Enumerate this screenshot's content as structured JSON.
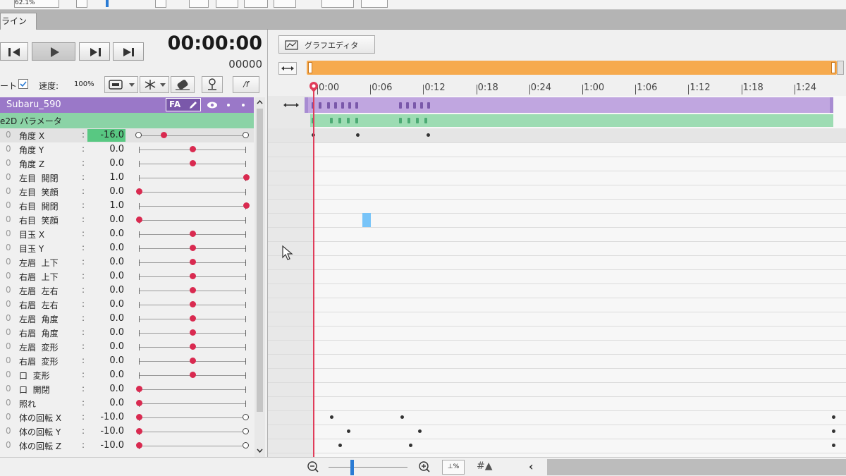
{
  "toolbar": {
    "zoom_fragment": "62.1%"
  },
  "tab": {
    "label": "ライン"
  },
  "playback": {
    "timecode": "00:00:00",
    "frame": "00000"
  },
  "options": {
    "label": "ート",
    "checked": true,
    "speed_label": "速度:",
    "speed_value": "100%",
    "script_label": "/f"
  },
  "layer": {
    "name": "Subaru_590",
    "badge": "FA"
  },
  "group": {
    "name": "e2D パラメータ"
  },
  "params": [
    {
      "name": "角度 X",
      "value": "-16.0",
      "pos": 0.23,
      "left_end": "circle",
      "right_end": "circle"
    },
    {
      "name": "角度 Y",
      "value": "0.0",
      "pos": 0.5,
      "left_end": "tick",
      "right_end": "tick"
    },
    {
      "name": "角度 Z",
      "value": "0.0",
      "pos": 0.5,
      "left_end": "tick",
      "right_end": "tick"
    },
    {
      "name": "左目  開閉",
      "value": "1.0",
      "pos": 1.0,
      "left_end": "tick",
      "right_end": "tick"
    },
    {
      "name": "左目  笑顔",
      "value": "0.0",
      "pos": 0.0,
      "left_end": "tick",
      "right_end": "tick"
    },
    {
      "name": "右目  開閉",
      "value": "1.0",
      "pos": 1.0,
      "left_end": "tick",
      "right_end": "tick"
    },
    {
      "name": "右目  笑顔",
      "value": "0.0",
      "pos": 0.0,
      "left_end": "tick",
      "right_end": "tick"
    },
    {
      "name": "目玉 X",
      "value": "0.0",
      "pos": 0.5,
      "left_end": "tick",
      "right_end": "tick"
    },
    {
      "name": "目玉 Y",
      "value": "0.0",
      "pos": 0.5,
      "left_end": "tick",
      "right_end": "tick"
    },
    {
      "name": "左眉  上下",
      "value": "0.0",
      "pos": 0.5,
      "left_end": "tick",
      "right_end": "tick"
    },
    {
      "name": "右眉  上下",
      "value": "0.0",
      "pos": 0.5,
      "left_end": "tick",
      "right_end": "tick"
    },
    {
      "name": "左眉  左右",
      "value": "0.0",
      "pos": 0.5,
      "left_end": "tick",
      "right_end": "tick"
    },
    {
      "name": "右眉  左右",
      "value": "0.0",
      "pos": 0.5,
      "left_end": "tick",
      "right_end": "tick"
    },
    {
      "name": "左眉  角度",
      "value": "0.0",
      "pos": 0.5,
      "left_end": "tick",
      "right_end": "tick"
    },
    {
      "name": "右眉  角度",
      "value": "0.0",
      "pos": 0.5,
      "left_end": "tick",
      "right_end": "tick"
    },
    {
      "name": "左眉  変形",
      "value": "0.0",
      "pos": 0.5,
      "left_end": "tick",
      "right_end": "tick"
    },
    {
      "name": "右眉  変形",
      "value": "0.0",
      "pos": 0.5,
      "left_end": "tick",
      "right_end": "tick"
    },
    {
      "name": "口  変形",
      "value": "0.0",
      "pos": 0.5,
      "left_end": "tick",
      "right_end": "tick"
    },
    {
      "name": "口  開閉",
      "value": "0.0",
      "pos": 0.0,
      "left_end": "tick",
      "right_end": "tick"
    },
    {
      "name": "照れ",
      "value": "0.0",
      "pos": 0.0,
      "left_end": "tick",
      "right_end": "tick"
    },
    {
      "name": "体の回転 X",
      "value": "-10.0",
      "pos": 0.0,
      "left_end": "tick",
      "right_end": "circle"
    },
    {
      "name": "体の回転 Y",
      "value": "-10.0",
      "pos": 0.0,
      "left_end": "tick",
      "right_end": "circle"
    },
    {
      "name": "体の回転 Z",
      "value": "-10.0",
      "pos": 0.0,
      "left_end": "tick",
      "right_end": "circle"
    }
  ],
  "graph_editor": {
    "label": "グラフエディタ"
  },
  "ruler": [
    "0:00",
    "0:06",
    "0:12",
    "0:18",
    "0:24",
    "1:00",
    "1:06",
    "1:12",
    "1:18",
    "1:24"
  ],
  "status": {
    "fit_label": "⊥%"
  },
  "colors": {
    "layer": "#9a78c8",
    "group": "#8bd3a6",
    "playhead": "#e03c5a",
    "handle": "#d92a50",
    "range": "#f6aa4e"
  }
}
